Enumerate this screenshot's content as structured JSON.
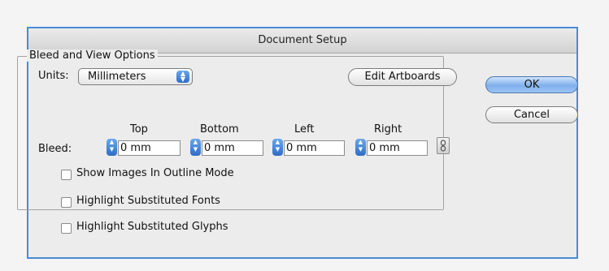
{
  "dialog": {
    "title": "Document Setup"
  },
  "bleed_group": {
    "legend": "Bleed and View Options",
    "units_label": "Units:",
    "units_value": "Millimeters",
    "edit_artboards_label": "Edit Artboards",
    "bleed_label": "Bleed:",
    "columns": {
      "top": "Top",
      "bottom": "Bottom",
      "left": "Left",
      "right": "Right"
    },
    "values": {
      "top": "0 mm",
      "bottom": "0 mm",
      "left": "0 mm",
      "right": "0 mm"
    },
    "link_icon": "chain-link-icon"
  },
  "options": [
    {
      "label": "Show Images In Outline Mode",
      "checked": false
    },
    {
      "label": "Highlight Substituted Fonts",
      "checked": false
    },
    {
      "label": "Highlight Substituted Glyphs",
      "checked": false
    }
  ],
  "buttons": {
    "ok": "OK",
    "cancel": "Cancel"
  },
  "colors": {
    "accent": "#4a8bd6",
    "stepper": "#3a7ad6"
  }
}
